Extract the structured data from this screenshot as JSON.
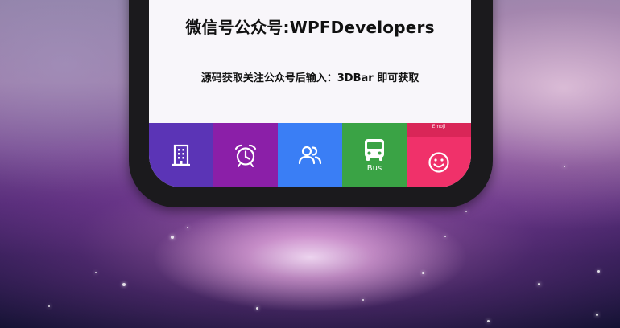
{
  "content": {
    "title": "微信号公众号:WPFDevelopers",
    "subtitle": "源码获取关注公众号后输入：3DBar 即可获取"
  },
  "tabbar": {
    "items": [
      {
        "icon": "building-icon",
        "color": "#5b34b6"
      },
      {
        "icon": "alarm-clock-icon",
        "color": "#8b1fa8"
      },
      {
        "icon": "users-icon",
        "color": "#3a7ef5"
      },
      {
        "icon": "bus-icon",
        "color": "#3aa345",
        "label": "Bus"
      },
      {
        "icon": "smiley-icon",
        "color": "#f0316a",
        "label": "Emoji"
      }
    ]
  },
  "colors": {
    "phone_frame": "#1b1a1d",
    "screen_bg": "#f8f6fa"
  }
}
